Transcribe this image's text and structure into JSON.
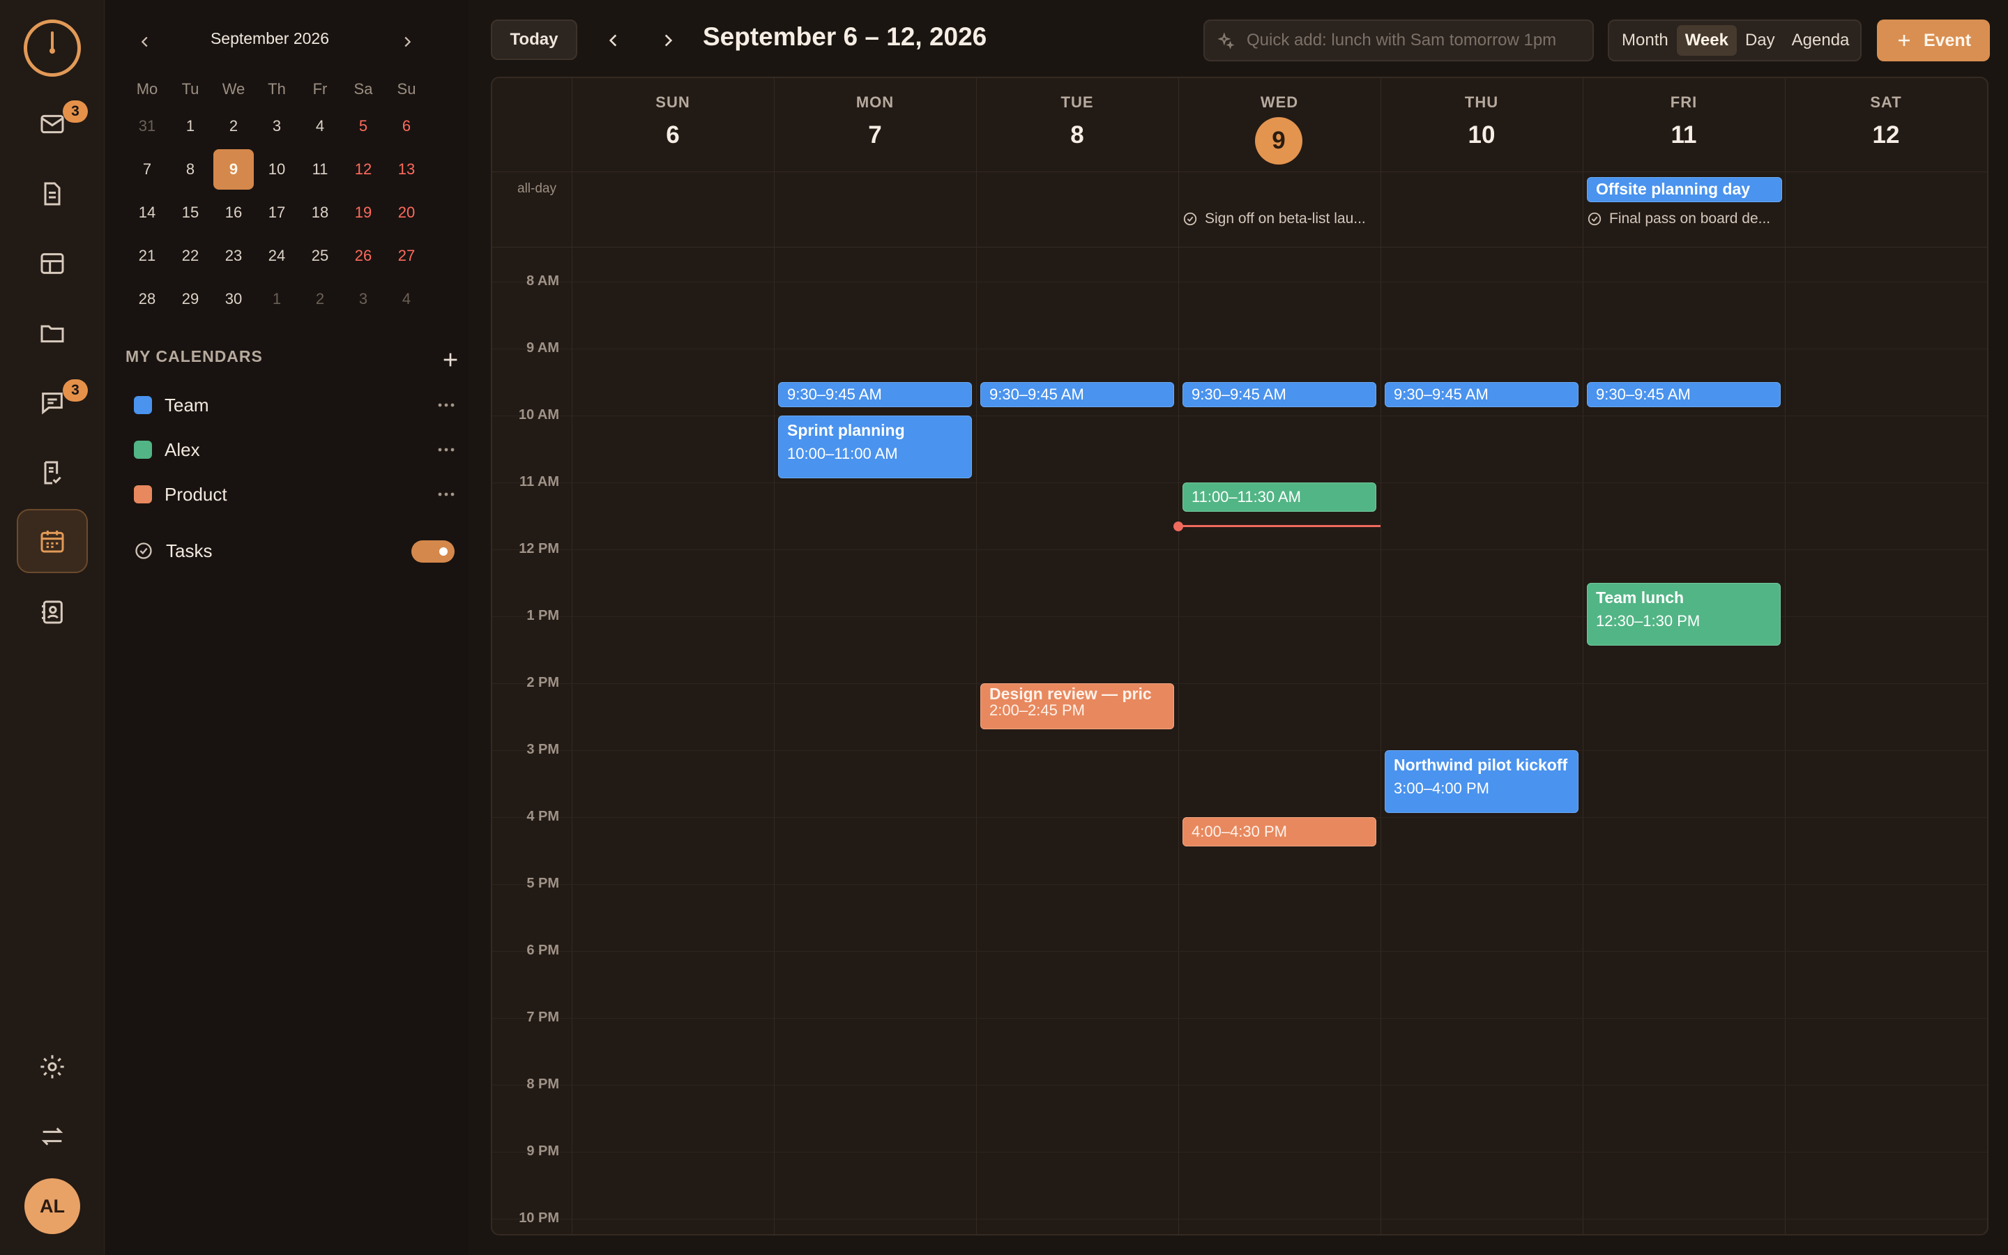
{
  "rail": {
    "mail_badge": "3",
    "chat_badge": "3",
    "avatar_initials": "AL"
  },
  "mini_calendar": {
    "title": "September 2026",
    "weekdays": [
      "Mo",
      "Tu",
      "We",
      "Th",
      "Fr",
      "Sa",
      "Su"
    ],
    "days": [
      "31",
      "1",
      "2",
      "3",
      "4",
      "5",
      "6",
      "7",
      "8",
      "9",
      "10",
      "11",
      "12",
      "13",
      "14",
      "15",
      "16",
      "17",
      "18",
      "19",
      "20",
      "21",
      "22",
      "23",
      "24",
      "25",
      "26",
      "27",
      "28",
      "29",
      "30",
      "1",
      "2",
      "3",
      "4"
    ]
  },
  "calendars": {
    "heading": "MY CALENDARS",
    "items": [
      {
        "label": "Team",
        "color": "#4a93ee"
      },
      {
        "label": "Alex",
        "color": "#52b585"
      },
      {
        "label": "Product",
        "color": "#e8885e"
      }
    ],
    "tasks_label": "Tasks"
  },
  "toolbar": {
    "today_label": "Today",
    "range_title": "September 6 – 12, 2026",
    "quick_add_placeholder": "Quick add: lunch with Sam tomorrow 1pm",
    "views": [
      "Month",
      "Week",
      "Day",
      "Agenda"
    ],
    "active_view": "Week",
    "event_label": "Event"
  },
  "week": {
    "days": [
      {
        "dow": "SUN",
        "num": "6"
      },
      {
        "dow": "MON",
        "num": "7"
      },
      {
        "dow": "TUE",
        "num": "8"
      },
      {
        "dow": "WED",
        "num": "9"
      },
      {
        "dow": "THU",
        "num": "10"
      },
      {
        "dow": "FRI",
        "num": "11"
      },
      {
        "dow": "SAT",
        "num": "12"
      }
    ],
    "allday_label": "all-day",
    "hours": [
      "8 AM",
      "9 AM",
      "10 AM",
      "11 AM",
      "12 PM",
      "1 PM",
      "2 PM",
      "3 PM",
      "4 PM",
      "5 PM",
      "6 PM",
      "7 PM",
      "8 PM",
      "9 PM",
      "10 PM"
    ],
    "allday_events": {
      "offsite": "Offsite planning day"
    },
    "tasks": {
      "wed": "Sign off on beta-list lau...",
      "fri": "Final pass on board de..."
    },
    "events": {
      "mon_930": "9:30–9:45 AM",
      "tue_930": "9:30–9:45 AM",
      "wed_930": "9:30–9:45 AM",
      "thu_930": "9:30–9:45 AM",
      "fri_930": "9:30–9:45 AM",
      "sprint_title": "Sprint planning",
      "sprint_time": "10:00–11:00 AM",
      "wed_11": "11:00–11:30 AM",
      "lunch_title": "Team lunch",
      "lunch_time": "12:30–1:30 PM",
      "design_title": "Design review — pric",
      "design_time": "2:00–2:45 PM",
      "northwind_title": "Northwind pilot kickoff",
      "northwind_time": "3:00–4:00 PM",
      "wed_4": "4:00–4:30 PM"
    }
  }
}
